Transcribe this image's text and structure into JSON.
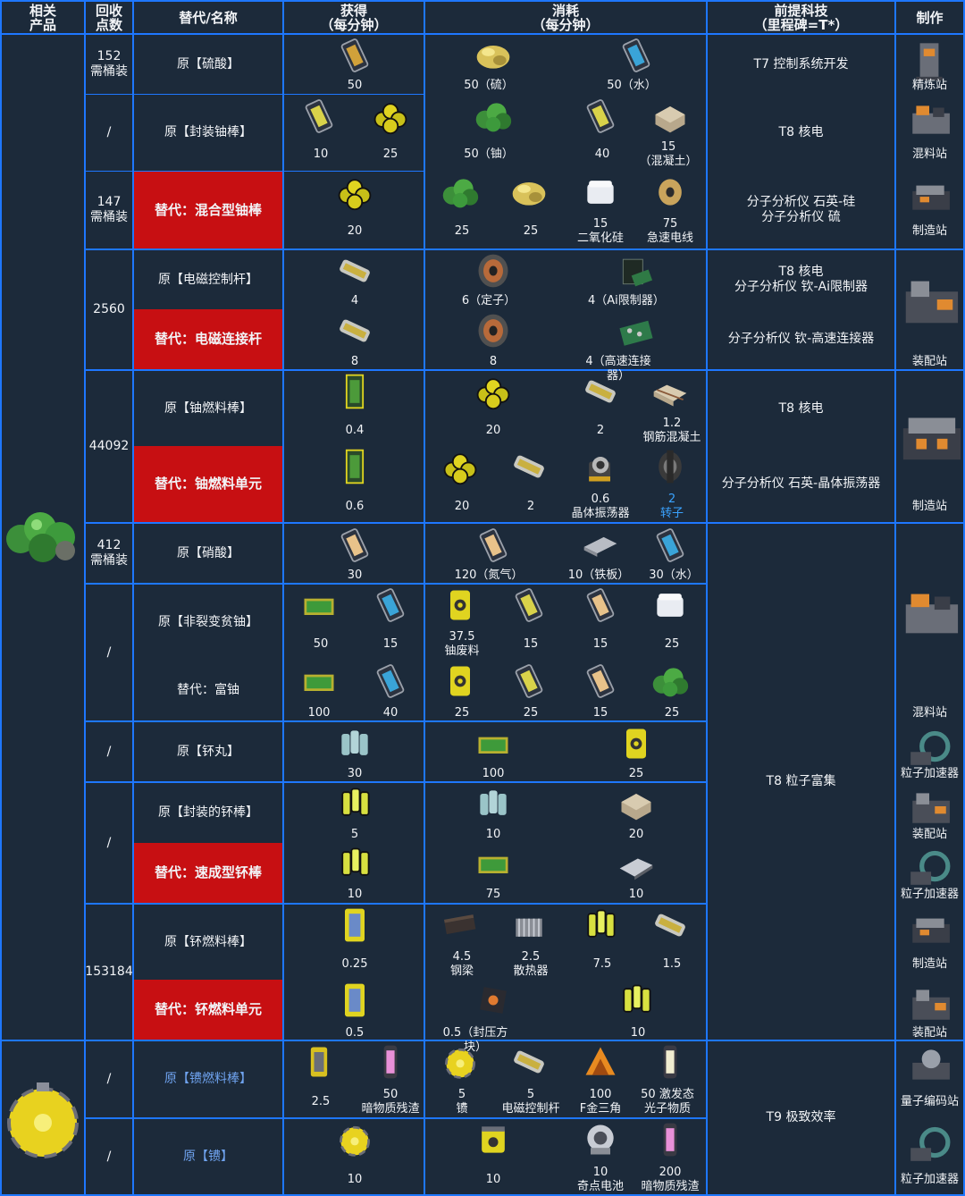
{
  "headers": {
    "product": "相关\n产品",
    "points": "回收\n点数",
    "recipe": "替代/名称",
    "output": "获得\n（每分钟）",
    "input": "消耗\n（每分钟）",
    "tech": "前提科技\n（里程碑=T*）",
    "machine": "制作"
  },
  "points": {
    "r1": "152\n需桶装",
    "r2": "/",
    "r3": "147\n需桶装",
    "r4": "2560",
    "r5": "44092",
    "r6": "412\n需桶装",
    "r7": "/",
    "r8": "/",
    "r9": "/",
    "r10": "153184",
    "r11": "/",
    "r12": "/"
  },
  "recipes": {
    "sulfuric_acid": "原【硫酸】",
    "encased_rod": "原【封装铀棒】",
    "infused_rod": "替代：混合型铀棒",
    "em_rod": "原【电磁控制杆】",
    "em_connection_rod": "替代：电磁连接杆",
    "uranium_fuel_rod": "原【铀燃料棒】",
    "uranium_fuel_unit": "替代：铀燃料单元",
    "nitric_acid": "原【硝酸】",
    "non_fissile": "原【非裂变贫铀】",
    "fertile": "替代：富铀",
    "plutonium_pellet": "原【钚丸】",
    "encased_plutonium": "原【封装的钚棒】",
    "instant_plutonium": "替代：速成型钚棒",
    "plutonium_fuel_rod": "原【钚燃料棒】",
    "plutonium_fuel_unit": "替代：钚燃料单元",
    "ficsonium_fuel_rod": "原【镄燃料棒】",
    "ficsonium": "原【镄】"
  },
  "tech": {
    "t1": "T7 控制系统开发",
    "t2": "T8 核电",
    "t3": "分子分析仪 石英-硅\n分子分析仪 硫",
    "t4": "T8 核电\n分子分析仪 钦-Ai限制器",
    "t5": "分子分析仪 钦-高速连接器",
    "t6": "T8 核电",
    "t7": "分子分析仪 石英-晶体振荡器",
    "t8": "T8 粒子富集",
    "t9": "T9 极致效率"
  },
  "machines": {
    "refinery": "精炼站",
    "blender1": "混料站",
    "constructor1": "制造站",
    "assembler1": "装配站",
    "manufacturer": "制造站",
    "blender2": "混料站",
    "accel1": "粒子加速器",
    "assembler2": "装配站",
    "accel2": "粒子加速器",
    "manufacturer2": "制造站",
    "assembler3": "装配站",
    "encoder": "量子编码站",
    "accel3": "粒子加速器"
  },
  "amounts": {
    "o1": "50",
    "i1a": "50（硫）",
    "i1b": "50（水）",
    "o2a": "10",
    "o2b": "25",
    "i2a": "50（铀）",
    "i2b": "40",
    "i2c": "15\n（混凝土）",
    "o3": "20",
    "i3a": "25",
    "i3b": "25",
    "i3c": "15\n二氧化硅",
    "i3d": "75\n急速电线",
    "o4": "4",
    "i4a": "6（定子）",
    "i4b": "4（Ai限制器）",
    "o5": "8",
    "i5a": "8",
    "i5b": "4（高速连接器）",
    "o6": "0.4",
    "i6a": "20",
    "i6b": "2",
    "i6c": "1.2\n钢筋混凝土",
    "o7": "0.6",
    "i7a": "20",
    "i7b": "2",
    "i7c": "0.6\n晶体振荡器",
    "i7d": "2\n转子",
    "o8": "30",
    "i8a": "120（氮气）",
    "i8b": "10（铁板）",
    "i8c": "30（水）",
    "o9a": "50",
    "o9b": "15",
    "i9a": "37.5\n铀废料",
    "i9b": "15",
    "i9c": "15",
    "i9d": "25",
    "o10a": "100",
    "o10b": "40",
    "i10a": "25",
    "i10b": "25",
    "i10c": "15",
    "i10d": "25",
    "o11": "30",
    "i11a": "100",
    "i11b": "25",
    "o12": "5",
    "i12a": "10",
    "i12b": "20",
    "o13": "10",
    "i13a": "75",
    "i13b": "10",
    "o14": "0.25",
    "i14a": "4.5\n钢梁",
    "i14b": "2.5\n散热器",
    "i14c": "7.5",
    "i14d": "1.5",
    "o15": "0.5",
    "i15a": "0.5（封压方块）",
    "i15b": "10",
    "o16a": "2.5",
    "o16b": "50\n暗物质残渣",
    "i16a": "5\n镄",
    "i16b": "5\n电磁控制杆",
    "i16c": "100\nF金三角",
    "i16d": "50 激发态\n光子物质",
    "o17": "10",
    "i17a": "10",
    "i17b": "10\n奇点电池",
    "i17c": "200\n暗物质残渣"
  },
  "colors": {
    "background": "#1c2a3a",
    "grid": "#1e77ff",
    "alt_recipe": "#c70f12",
    "blue_text": "#6fa3ef"
  }
}
